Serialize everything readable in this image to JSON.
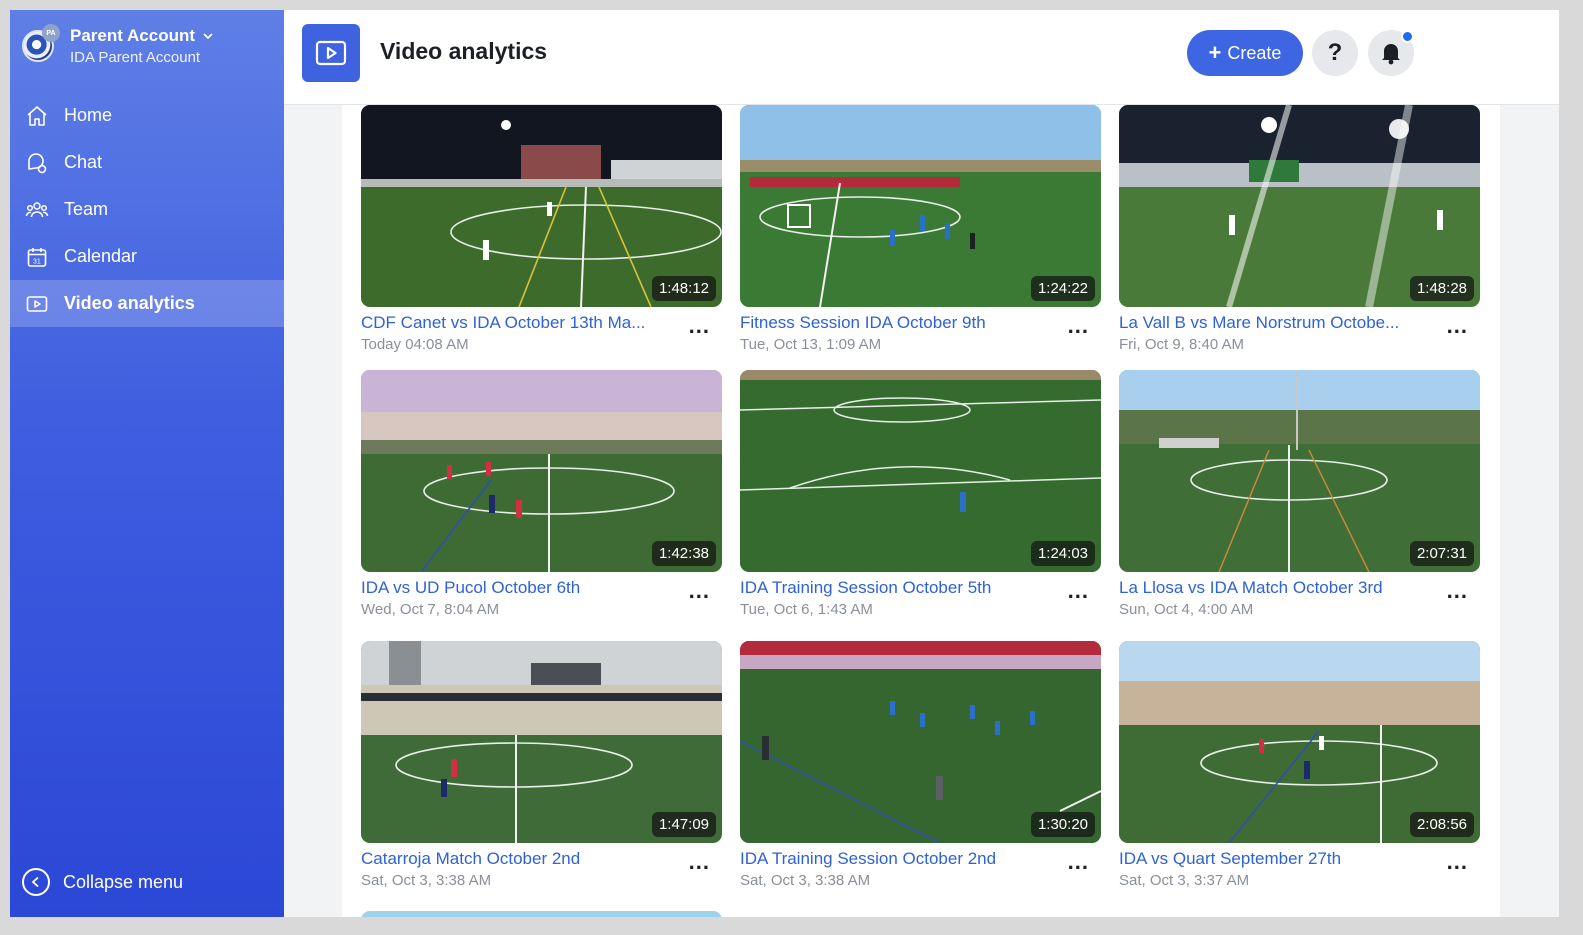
{
  "account": {
    "name": "Parent Account",
    "subtitle": "IDA Parent Account",
    "avatar_badge": "PA"
  },
  "nav": [
    {
      "label": "Home",
      "icon": "home-icon"
    },
    {
      "label": "Chat",
      "icon": "chat-icon"
    },
    {
      "label": "Team",
      "icon": "team-icon"
    },
    {
      "label": "Calendar",
      "icon": "calendar-icon"
    },
    {
      "label": "Video analytics",
      "icon": "video-icon",
      "active": true
    }
  ],
  "collapse_label": "Collapse menu",
  "header": {
    "title": "Video analytics",
    "create_label": "Create",
    "help_label": "?"
  },
  "colors": {
    "accent": "#3f66e2",
    "link": "#2e62d6",
    "notification": "#1f6cf2"
  },
  "videos": [
    {
      "title": "CDF Canet vs IDA October 13th Ma...",
      "date": "Today 04:08 AM",
      "duration": "1:48:12"
    },
    {
      "title": "Fitness Session IDA October 9th",
      "date": "Tue, Oct 13, 1:09 AM",
      "duration": "1:24:22"
    },
    {
      "title": "La Vall B vs Mare Norstrum Octobe...",
      "date": "Fri, Oct 9, 8:40 AM",
      "duration": "1:48:28"
    },
    {
      "title": "IDA vs UD Pucol October 6th",
      "date": "Wed, Oct 7, 8:04 AM",
      "duration": "1:42:38"
    },
    {
      "title": "IDA Training Session October 5th",
      "date": "Tue, Oct 6, 1:43 AM",
      "duration": "1:24:03"
    },
    {
      "title": "La Llosa vs IDA Match October 3rd",
      "date": "Sun, Oct 4, 4:00 AM",
      "duration": "2:07:31"
    },
    {
      "title": "Catarroja Match October 2nd",
      "date": "Sat, Oct 3, 3:38 AM",
      "duration": "1:47:09"
    },
    {
      "title": "IDA Training Session October 2nd",
      "date": "Sat, Oct 3, 3:38 AM",
      "duration": "1:30:20"
    },
    {
      "title": "IDA vs Quart September 27th",
      "date": "Sat, Oct 3, 3:37 AM",
      "duration": "2:08:56"
    }
  ]
}
